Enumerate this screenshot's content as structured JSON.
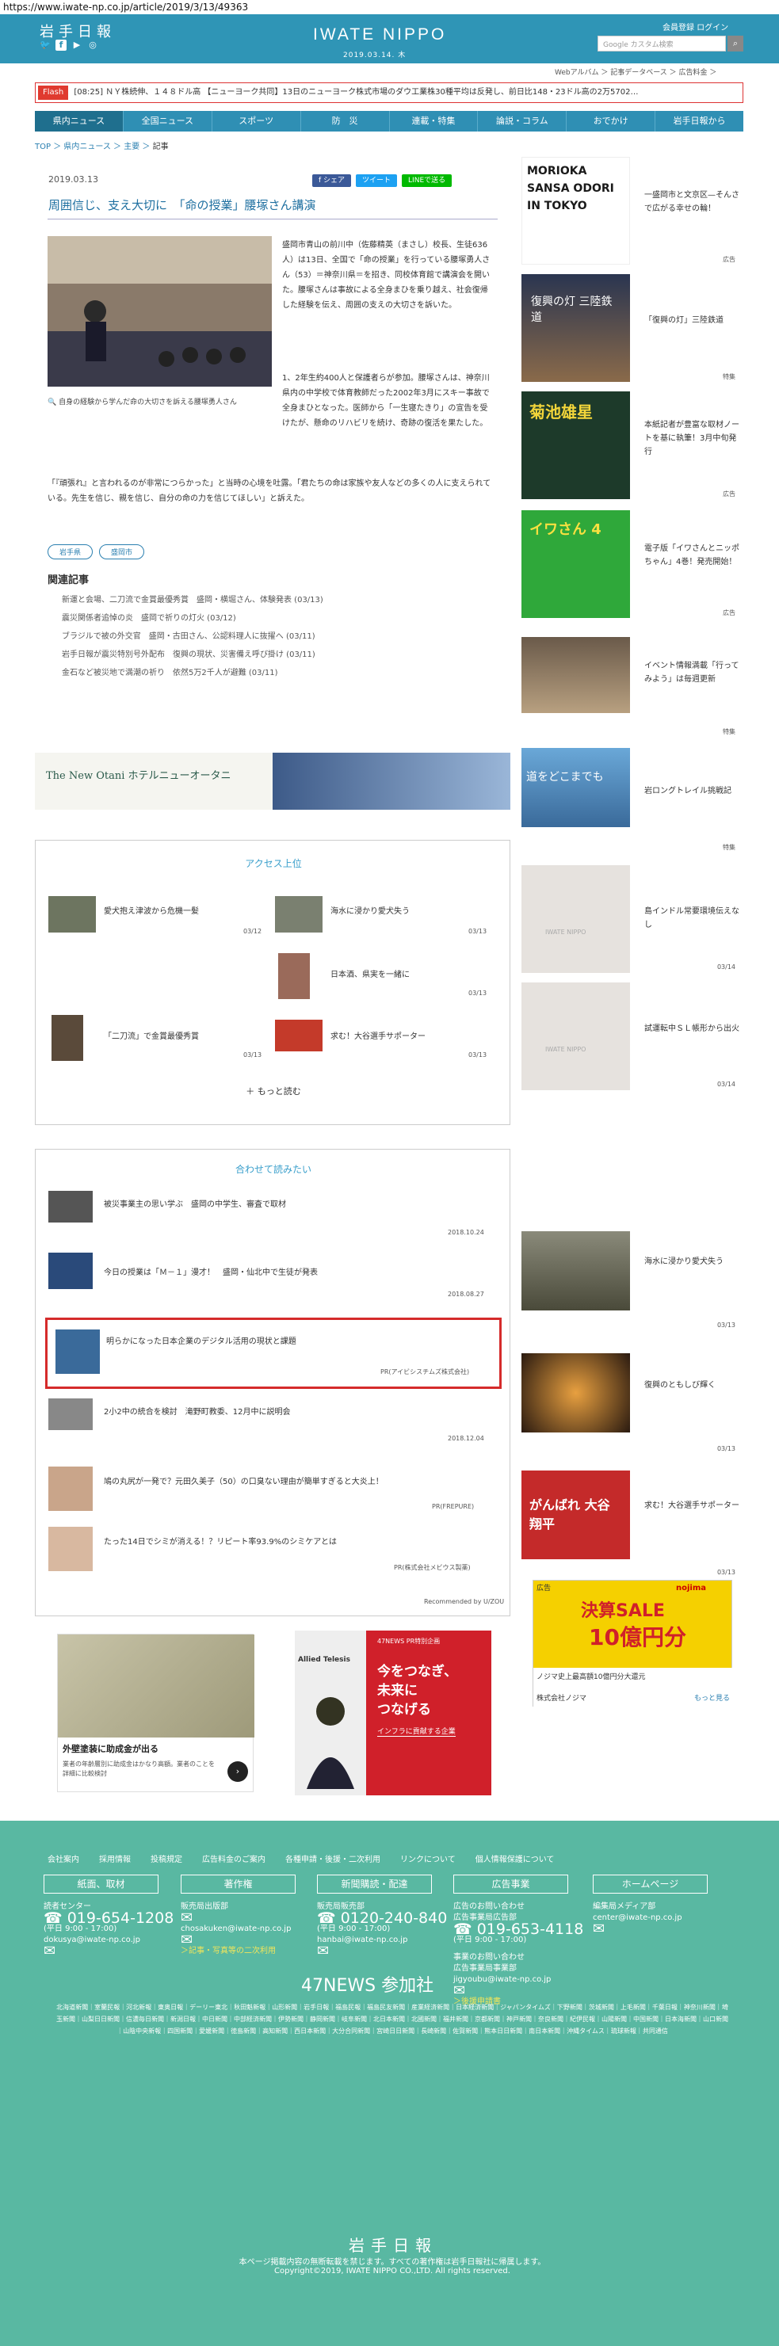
{
  "url": "https://www.iwate-np.co.jp/article/2019/3/13/49363",
  "header": {
    "logo": "岩手日報",
    "brand": "IWATE NIPPO",
    "date": "2019.03.14. 木",
    "links": "会員登録 ログイン",
    "search_placeholder": "Google カスタム検索",
    "subnav": "Webアルバム ＞ 記事データベース ＞ 広告料金 ＞"
  },
  "ticker": {
    "flash": "Flash",
    "time": "[08:25]",
    "text": "ＮＹ株続伸、１４８ドル高  【ニューヨーク共同】13日のニューヨーク株式市場のダウ工業株30種平均は反発し、前日比148・23ドル高の2万5702…"
  },
  "nav": [
    "県内ニュース",
    "全国ニュース",
    "スポーツ",
    "防　災",
    "連載・特集",
    "論説・コラム",
    "おでかけ",
    "岩手日報から"
  ],
  "breadcrumb": {
    "a": "TOP",
    "b": "県内ニュース",
    "c": "主要",
    "d": "記事"
  },
  "article": {
    "date": "2019.03.13",
    "title": "周囲信じ、支え大切に　「命の授業」腰塚さん講演",
    "share": [
      "f シェア",
      "ツイート",
      "LINEで送る"
    ],
    "caption": "自身の経験から学んだ命の大切さを訴える腰塚勇人さん",
    "p1": "盛岡市青山の前川中（佐藤精英（まさし）校長、生徒636人）は13日、全国で「命の授業」を行っている腰塚勇人さん（53）＝神奈川県＝を招き、同校体育館で講演会を開いた。腰塚さんは事故による全身まひを乗り越え、社会復帰した経験を伝え、周囲の支えの大切さを訴いた。",
    "p2": "1、2年生約400人と保護者らが参加。腰塚さんは、神奈川県内の中学校で体育教師だった2002年3月にスキー事故で全身まひとなった。医師から「一生寝たきり」の宣告を受けたが、懸命のリハビリを続け、奇跡の復活を果たした。",
    "p3": "「『頑張れ』と言われるのが非常につらかった」と当時の心境を吐露。「君たちの命は家族や友人などの多くの人に支えられている。先生を信じ、親を信じ、自分の命の力を信じてほしい」と訴えた。",
    "tags": [
      "岩手県",
      "盛岡市"
    ],
    "related_heading": "関連記事",
    "related": [
      "新運と会場、二刀流で金賞最優秀賞　盛岡・横堀さん、体験発表 (03/13)",
      "震災関係者追悼の炎　盛岡で祈りの灯火 (03/12)",
      "ブラジルで被の外交官　盛岡・古田さん、公認料理人に抜擢へ (03/11)",
      "岩手日報が震災特別号外配布　復興の現状、災害備え呼び掛け (03/11)",
      "金石など被災地で満潮の祈り　依然5万2千人が避難 (03/11)"
    ]
  },
  "hotel_banner": "The New Otani  ホテルニューオータニ",
  "access": {
    "title": "アクセス上位",
    "items": [
      {
        "t": "愛犬抱え津波から危機一髪",
        "d": "03/12"
      },
      {
        "t": "海水に浸かり愛犬失う",
        "d": "03/13"
      },
      {
        "t": "日本酒、県実を一緒に",
        "d": "03/13"
      },
      {
        "t": "「二刀流」で金賞最優秀賞",
        "d": "03/13"
      },
      {
        "t": "求む！大谷選手サポーター",
        "d": "03/13"
      }
    ],
    "more": "もっと読む"
  },
  "recommend": {
    "title": "合わせて読みたい",
    "items": [
      {
        "t": "被災事業主の思い学ぶ　盛岡の中学生、審査で取材",
        "d": "2018.10.24"
      },
      {
        "t": "今日の授業は「Ｍ－１」漫才！　盛岡・仙北中で生徒が発表",
        "d": "2018.08.27"
      },
      {
        "t": "明らかになった日本企業のデジタル活用の現状と課題",
        "d": "PR(アイビシスチムズ株式会社)"
      },
      {
        "t": "2小2中の統合を検討　滝野町教委、12月中に説明会",
        "d": "2018.12.04"
      },
      {
        "t": "鳩の丸尻が一発で？元田久美子（50）の口臭ない理由が簡単すぎると大炎上！",
        "d": "PR(FREPURE)"
      },
      {
        "t": "たった14日でシミが消える！？リピート率93.9%のシミケアとは",
        "d": "PR(株式会社メビウス製薬)"
      }
    ],
    "powered": "Recommended by U/ZOU"
  },
  "ads": {
    "paint_title": "外壁塗装に助成金が出る",
    "paint_sub": "業者の年齢層別に助成金はかなり高額。業者のことを詳細に比較検討",
    "allied_line1": "今をつなぎ、",
    "allied_line2": "未来に",
    "allied_line3": "つなげる",
    "allied_sub": "インフラに貢献する企業",
    "allied_brand": "Allied Telesis",
    "allied_pr": "47NEWS PR特別企画"
  },
  "sidebar": [
    {
      "t": "一盛岡市と文京区—そんさで広がる幸せの輪！",
      "l": "広告",
      "thumb": "MORIOKA SANSA ODORI IN TOKYO"
    },
    {
      "t": "「復興の灯」三陸鉄道",
      "l": "特集",
      "thumb": "復興の灯 三陸鉄道"
    },
    {
      "t": "本紙記者が豊富な取材ノートを基に執筆！3月中旬発行",
      "l": "広告",
      "thumb": "菊池雄星"
    },
    {
      "t": "電子版「イワさんとニッポちゃん」4巻！発売開始！",
      "l": "広告",
      "thumb": "イワさん 4"
    },
    {
      "t": "イベント情報満載「行ってみよう」は毎週更新",
      "l": "特集",
      "thumb": ""
    },
    {
      "t": "岩ロングトレイル挑戦記",
      "l": "特集",
      "thumb": "道をどこまでも"
    },
    {
      "t": "島インドル常要環境伝えなし",
      "l": "03/14",
      "thumb": "IWATE NIPPO"
    },
    {
      "t": "試運転中ＳＬ帳形から出火",
      "l": "03/14",
      "thumb": "IWATE NIPPO"
    },
    {
      "t": "海水に浸かり愛犬失う",
      "l": "03/13",
      "thumb": ""
    },
    {
      "t": "復興のともしび輝く",
      "l": "03/13",
      "thumb": ""
    },
    {
      "t": "求む！大谷選手サポーター",
      "l": "03/13",
      "thumb": "がんばれ 大谷翔平"
    }
  ],
  "nojima": {
    "brand": "nojima",
    "title": "決算SALE",
    "amount": "10億円分",
    "sub": "ノジマ史上最高額10億円分大還元",
    "company": "株式会社ノジマ",
    "more": "もっと見る",
    "label": "広告"
  },
  "footer": {
    "links": [
      "会社案内",
      "採用情報",
      "投稿規定",
      "広告料金のご案内",
      "各種申請・後援・二次利用",
      "リンクについて",
      "個人情報保護について"
    ],
    "buttons": [
      "紙面、取材",
      "著作権",
      "新聞購読・配達",
      "広告事業",
      "ホームページ"
    ],
    "c1_label": "読者センター",
    "c1_phone": "019-654-1208",
    "c1_hours": "(平日 9:00 - 17:00)",
    "c1_mail": "dokusya@iwate-np.co.jp",
    "c2_label": "販売局出版部",
    "c2_mail": "chosakuken@iwate-np.co.jp",
    "c2_link": "＞記事・写真等の二次利用",
    "c3_label": "販売局販売部",
    "c3_phone": "0120-240-840",
    "c3_hours": "(平日 9:00 - 17:00)",
    "c3_mail": "hanbai@iwate-np.co.jp",
    "c4_label1": "広告のお問い合わせ",
    "c4_label2": "広告事業局広告部",
    "c4_phone": "019-653-4118",
    "c4_hours": "(平日 9:00 - 17:00)",
    "c4_label3": "事業のお問い合わせ",
    "c4_label4": "広告事業局事業部",
    "c4_mail": "jigyoubu@iwate-np.co.jp",
    "c4_link": "＞後援申請書",
    "c5_label": "編集局メディア部",
    "c5_mail": "center@iwate-np.co.jp",
    "news47": "47NEWS 参加社",
    "papers": "北海道新聞｜室蘭民報｜河北新報｜東奥日報｜デーリー東北｜秋田魁新報｜山形新聞｜岩手日報｜福島民報｜福島民友新聞｜産業経済新聞｜日本経済新聞｜ジャパンタイムズ｜下野新聞｜茨城新聞｜上毛新聞｜千葉日報｜神奈川新聞｜埼玉新聞｜山梨日日新聞｜信濃毎日新聞｜新潟日報｜中日新聞｜中部経済新聞｜伊勢新聞｜静岡新聞｜岐阜新聞｜北日本新聞｜北國新聞｜福井新聞｜京都新聞｜神戸新聞｜奈良新聞｜紀伊民報｜山陽新聞｜中国新聞｜日本海新聞｜山口新聞｜山陰中央新報｜四国新聞｜愛媛新聞｜徳島新聞｜高知新聞｜西日本新聞｜大分合同新聞｜宮崎日日新聞｜長崎新聞｜佐賀新聞｜熊本日日新聞｜南日本新聞｜沖縄タイムス｜琉球新報｜共同通信",
    "logo": "岩手日報",
    "notice": "本ページ掲載内容の無断転載を禁じます。すべての著作権は岩手日報社に帰属します。",
    "copy": "Copyright©2019, IWATE NIPPO CO.,LTD. All rights reserved."
  }
}
